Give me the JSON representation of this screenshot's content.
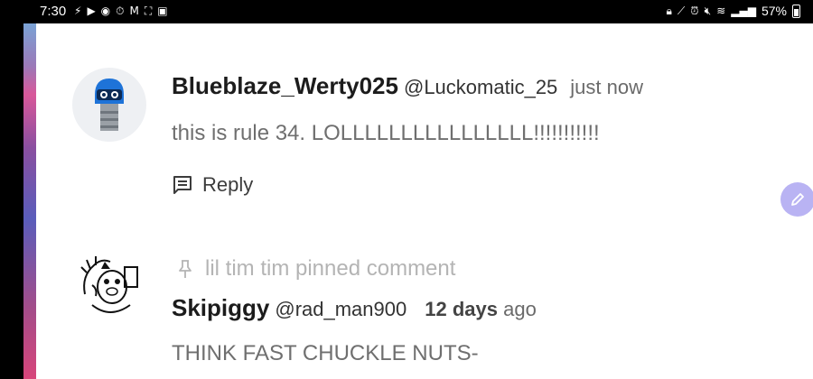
{
  "status_bar": {
    "time": "7:30",
    "battery_percent": "57%",
    "left_icons": [
      "flash-icon",
      "youtube-icon",
      "chrome-icon",
      "timer-icon",
      "gmail-icon",
      "screenshot-icon",
      "image-icon"
    ],
    "right_icons": [
      "lock-icon",
      "signal-off-icon",
      "alarm-icon",
      "mute-icon",
      "wifi-icon",
      "cell-signal-icon",
      "battery-icon"
    ]
  },
  "comments": [
    {
      "author": "Blueblaze_Werty025",
      "handle": "@Luckomatic_25",
      "time": "just now",
      "text": "this is rule 34. LOLLLLLLLLLLLLLLLL!!!!!!!!!!!",
      "reply_label": "Reply"
    },
    {
      "pinned_label": "lil tim tim pinned comment",
      "author": "Skipiggy",
      "handle": "@rad_man900",
      "time_bold": "12 days",
      "time_suffix": "ago",
      "text": "THINK FAST CHUCKLE NUTS-"
    }
  ],
  "colors": {
    "accent_fab": "#b9b3f3",
    "avatar_blue": "#1e73d8"
  }
}
